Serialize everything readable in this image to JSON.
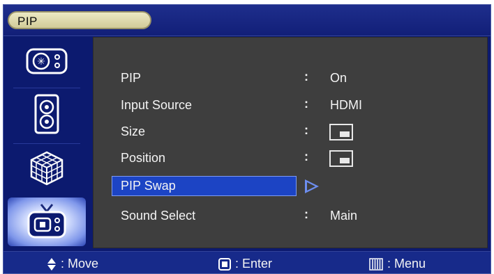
{
  "title": "PIP",
  "sidebar": {
    "items": [
      {
        "icon": "picture-settings-icon"
      },
      {
        "icon": "speaker-icon"
      },
      {
        "icon": "cube-icon"
      },
      {
        "icon": "tv-setup-icon",
        "active": true
      }
    ]
  },
  "menu": {
    "rows": [
      {
        "label": "PIP",
        "value": "On"
      },
      {
        "label": "Input Source",
        "value": "HDMI"
      },
      {
        "label": "Size",
        "value": "",
        "value_icon": "pip-size-icon"
      },
      {
        "label": "Position",
        "value": "",
        "value_icon": "pip-position-icon"
      },
      {
        "label": "PIP Swap",
        "value": "",
        "selected": true,
        "value_icon": "arrow-right-icon"
      },
      {
        "label": "Sound Select",
        "value": "Main"
      }
    ],
    "colon": ":"
  },
  "footer": {
    "move": ": Move",
    "enter": ": Enter",
    "menu": ": Menu"
  },
  "colors": {
    "background": "#0c1a6f",
    "panel": "#3e3e3e",
    "selection": "#1c44c4",
    "title_pill": "#e3dfb4"
  }
}
